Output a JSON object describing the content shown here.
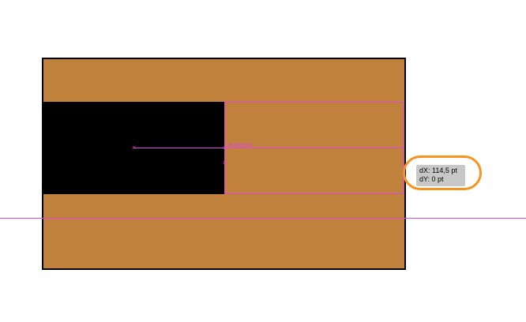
{
  "colors": {
    "artboard_fill": "#c0823c",
    "artboard_border": "#000000",
    "black_shape": "#000000",
    "smart_guide": "#e046e0",
    "tooltip_bg": "#c8c8c8",
    "highlight_ring": "#f7931e"
  },
  "guides": {
    "intersect_label": "intersect",
    "cross_glyph": "×"
  },
  "tooltip": {
    "dx": "dX: 114,5 pt",
    "dy": "dY: 0 pt"
  }
}
